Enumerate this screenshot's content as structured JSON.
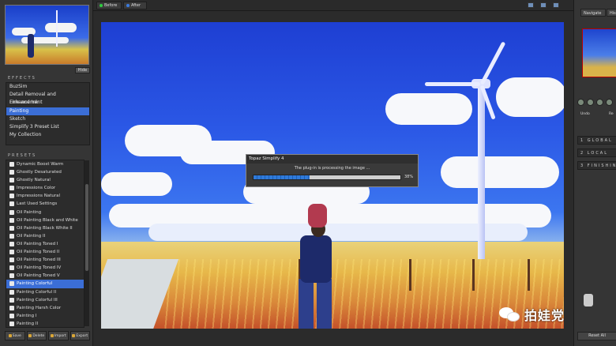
{
  "app": {
    "title": "Topaz Simplify 4"
  },
  "left_panel": {
    "hide_label": "Hide",
    "effects_title": "EFFECTS",
    "effects": [
      "BuzSim",
      "Detail Removal and Enhancement",
      "Line and Ink",
      "Painting",
      "Sketch",
      "Simplify 3 Preset List",
      "My Collection"
    ],
    "effects_selected": "Painting",
    "presets_title": "PRESETS",
    "presets": [
      "Dynamic Boost Warm",
      "Ghostly Desaturated",
      "Ghostly Natural",
      "Impressions Color",
      "Impressions Natural",
      "Last Used Settings",
      "Oil Painting",
      "Oil Painting Black and White",
      "Oil Painting Black White II",
      "Oil Painting II",
      "Oil Painting Toned I",
      "Oil Painting Toned II",
      "Oil Painting Toned III",
      "Oil Painting Toned IV",
      "Oil Painting Toned V",
      "Painting Colorful",
      "Painting Colorful II",
      "Painting Colorful III",
      "Painting Harsh Color",
      "Painting I",
      "Painting II"
    ],
    "presets_selected": "Painting Colorful",
    "bottom_buttons": [
      "Save",
      "Delete",
      "Import",
      "Export"
    ]
  },
  "topbar": {
    "tab_before": "Before",
    "tab_after": "After"
  },
  "dialog": {
    "title": "Topaz Simplify 4",
    "message": "The plug-in is processing the image ...",
    "progress": 0.38,
    "progress_label": "38%"
  },
  "right_panel": {
    "tab_navigate": "Navigate",
    "tab_histogram": "Hist",
    "undo_label": "Undo",
    "redo_label": "Re",
    "sections": [
      "1 GLOBAL",
      "2 LOCAL",
      "3 FINISHING"
    ],
    "reset_label": "Reset All"
  },
  "watermark": {
    "text": "拍娃党"
  },
  "colors": {
    "accent": "#3b6ed6",
    "panel": "#353535",
    "progress": "#2f7ad9"
  }
}
